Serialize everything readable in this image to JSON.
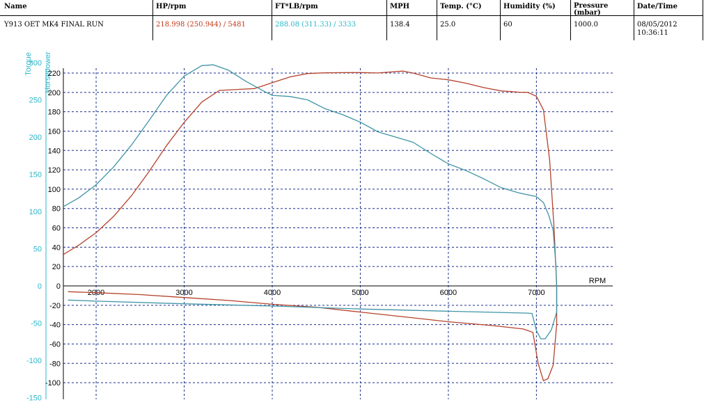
{
  "results_table": {
    "headers": [
      "Name",
      "HP/rpm",
      "FT*LB/rpm",
      "MPH",
      "Temp. (°C)",
      "Humidity (%)",
      "Pressure (mbar)",
      "Date/Time"
    ],
    "row": {
      "name": "Y913  OET MK4 FINAL RUN",
      "hp_rpm": "218.998 (250.944) / 5481",
      "ftlb_rpm": "288.08 (311.33) / 3333",
      "mph": "138.4",
      "temp": "25.0",
      "humidity": "60",
      "pressure": "1000.0",
      "datetime": "08/05/2012 10:36:11"
    },
    "colors": {
      "hp": "#c0391b",
      "torque": "#2ab7c9"
    }
  },
  "chart_data": {
    "type": "line",
    "x_unit": "RPM",
    "xlim": [
      1620,
      7250
    ],
    "x_ticks": [
      2000,
      3000,
      4000,
      5000,
      6000,
      7000
    ],
    "torque_axis": {
      "label": "Torque",
      "ticks": [
        300,
        250,
        200,
        150,
        100,
        50,
        0,
        -50,
        -100,
        -150
      ],
      "color": "#2ab7c9"
    },
    "hp_axis": {
      "label": "Horsepower",
      "ticks": [
        220,
        200,
        180,
        160,
        140,
        120,
        100,
        80,
        60,
        40,
        20,
        0,
        -20,
        -40,
        -60,
        -80,
        -100
      ],
      "color": "#2ab7c9"
    },
    "grid": true,
    "series": [
      {
        "axis": "hp",
        "color": "#b5412a",
        "points": [
          [
            1620,
            32
          ],
          [
            1800,
            42
          ],
          [
            2000,
            55
          ],
          [
            2200,
            72
          ],
          [
            2400,
            93
          ],
          [
            2600,
            118
          ],
          [
            2800,
            145
          ],
          [
            3000,
            169
          ],
          [
            3200,
            190
          ],
          [
            3400,
            202
          ],
          [
            3600,
            203
          ],
          [
            3800,
            204
          ],
          [
            4000,
            210
          ],
          [
            4200,
            216
          ],
          [
            4400,
            219.5
          ],
          [
            4600,
            220.2
          ],
          [
            4800,
            220.4
          ],
          [
            5000,
            220.5
          ],
          [
            5200,
            220.1
          ],
          [
            5481,
            222
          ],
          [
            5600,
            220
          ],
          [
            5800,
            215
          ],
          [
            6000,
            213
          ],
          [
            6200,
            209.5
          ],
          [
            6400,
            205
          ],
          [
            6600,
            201.5
          ],
          [
            6800,
            200.2
          ],
          [
            6900,
            200
          ],
          [
            7000,
            196
          ],
          [
            7080,
            182
          ],
          [
            7150,
            130
          ],
          [
            7200,
            60
          ],
          [
            7230,
            0
          ],
          [
            7230,
            -40
          ],
          [
            7190,
            -82
          ],
          [
            7130,
            -96
          ],
          [
            7080,
            -98
          ],
          [
            7020,
            -80
          ],
          [
            6960,
            -48
          ],
          [
            6850,
            -44.5
          ],
          [
            6500,
            -41
          ],
          [
            6000,
            -37
          ],
          [
            5500,
            -32
          ],
          [
            5000,
            -27
          ],
          [
            4500,
            -22
          ],
          [
            4000,
            -19
          ],
          [
            3500,
            -15
          ],
          [
            3000,
            -12
          ],
          [
            2500,
            -9
          ],
          [
            2000,
            -7
          ],
          [
            1680,
            -6
          ]
        ]
      },
      {
        "axis": "torque",
        "color": "#3f94a6",
        "points": [
          [
            1620,
            106
          ],
          [
            1800,
            118
          ],
          [
            2000,
            136
          ],
          [
            2200,
            160
          ],
          [
            2400,
            189
          ],
          [
            2600,
            222
          ],
          [
            2800,
            256
          ],
          [
            3000,
            282
          ],
          [
            3200,
            296
          ],
          [
            3333,
            297
          ],
          [
            3500,
            290
          ],
          [
            3700,
            275
          ],
          [
            3900,
            262
          ],
          [
            4000,
            256
          ],
          [
            4200,
            254.5
          ],
          [
            4400,
            250
          ],
          [
            4600,
            238
          ],
          [
            4800,
            230
          ],
          [
            5000,
            220
          ],
          [
            5200,
            207
          ],
          [
            5400,
            200
          ],
          [
            5600,
            193
          ],
          [
            5800,
            178
          ],
          [
            6000,
            164
          ],
          [
            6200,
            155
          ],
          [
            6400,
            144
          ],
          [
            6600,
            132
          ],
          [
            6800,
            125
          ],
          [
            7000,
            120
          ],
          [
            7080,
            112
          ],
          [
            7140,
            95
          ],
          [
            7190,
            75
          ],
          [
            7220,
            30
          ],
          [
            7230,
            0
          ],
          [
            7230,
            -35
          ],
          [
            7170,
            -59
          ],
          [
            7100,
            -71
          ],
          [
            7050,
            -71
          ],
          [
            7000,
            -60
          ],
          [
            6950,
            -37
          ],
          [
            6900,
            -36.5
          ],
          [
            6000,
            -34
          ],
          [
            5000,
            -31
          ],
          [
            4000,
            -27
          ],
          [
            3000,
            -24
          ],
          [
            2000,
            -20.5
          ],
          [
            1680,
            -19
          ]
        ]
      }
    ]
  }
}
